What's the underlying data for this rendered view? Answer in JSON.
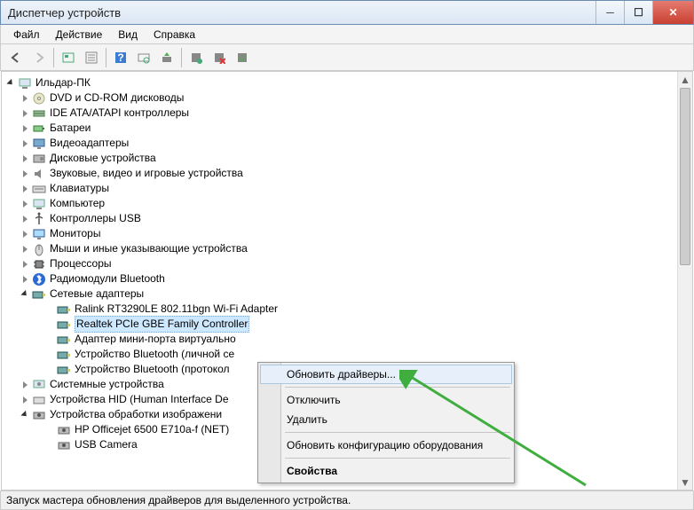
{
  "window": {
    "title": "Диспетчер устройств"
  },
  "menu": {
    "file": "Файл",
    "action": "Действие",
    "view": "Вид",
    "help": "Справка"
  },
  "status": "Запуск мастера обновления драйверов для выделенного устройства.",
  "tree": {
    "root": "Ильдар-ПК",
    "categories": [
      {
        "label": "DVD и CD-ROM дисководы",
        "icon": "disc"
      },
      {
        "label": "IDE ATA/ATAPI контроллеры",
        "icon": "ide"
      },
      {
        "label": "Батареи",
        "icon": "battery"
      },
      {
        "label": "Видеоадаптеры",
        "icon": "display"
      },
      {
        "label": "Дисковые устройства",
        "icon": "disk"
      },
      {
        "label": "Звуковые, видео и игровые устройства",
        "icon": "sound"
      },
      {
        "label": "Клавиатуры",
        "icon": "keyboard"
      },
      {
        "label": "Компьютер",
        "icon": "computer"
      },
      {
        "label": "Контроллеры USB",
        "icon": "usb"
      },
      {
        "label": "Мониторы",
        "icon": "monitor"
      },
      {
        "label": "Мыши и иные указывающие устройства",
        "icon": "mouse"
      },
      {
        "label": "Процессоры",
        "icon": "cpu"
      },
      {
        "label": "Радиомодули Bluetooth",
        "icon": "bluetooth"
      }
    ],
    "network": {
      "label": "Сетевые адаптеры",
      "children": [
        "Ralink RT3290LE 802.11bgn Wi-Fi Adapter",
        "Realtek PCIe GBE Family Controller",
        "Адаптер мини-порта виртуально",
        "Устройство Bluetooth (личной се",
        "Устройство Bluetooth (протокол"
      ]
    },
    "after": [
      {
        "label": "Системные устройства",
        "icon": "system"
      },
      {
        "label": "Устройства HID (Human Interface De",
        "icon": "hid"
      }
    ],
    "imaging": {
      "label": "Устройства обработки изображени",
      "children": [
        "HP Officejet 6500 E710a-f (NET)",
        "USB Camera"
      ]
    }
  },
  "context_menu": {
    "update": "Обновить драйверы...",
    "disable": "Отключить",
    "delete": "Удалить",
    "scan": "Обновить конфигурацию оборудования",
    "properties": "Свойства"
  }
}
